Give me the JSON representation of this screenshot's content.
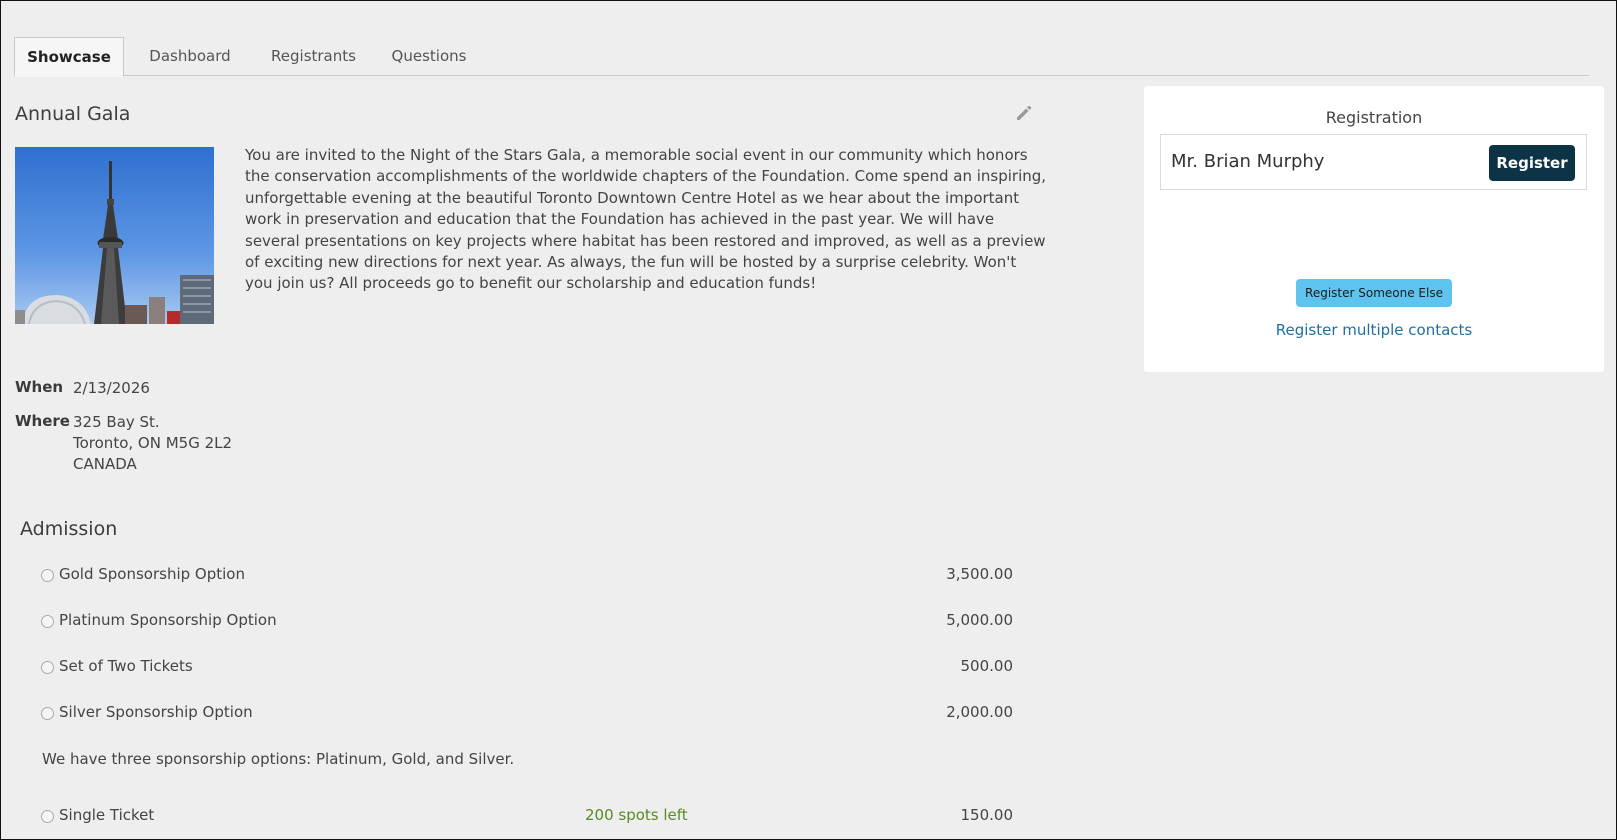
{
  "tabs": [
    {
      "label": "Showcase",
      "active": true
    },
    {
      "label": "Dashboard",
      "active": false
    },
    {
      "label": "Registrants",
      "active": false
    },
    {
      "label": "Questions",
      "active": false
    }
  ],
  "event": {
    "title": "Annual Gala",
    "description": "You are invited to the Night of the Stars Gala, a memorable social event in our community which honors the conservation accomplishments of the worldwide chapters of the Foundation. Come spend an inspiring, unforgettable evening at the beautiful Toronto Downtown Centre Hotel as we hear about the important work in preservation and education that the Foundation has achieved in the past year. We will have several presentations on key projects where habitat has been restored and improved, as well as a preview of exciting new directions for next year. As always, the fun will be hosted by a surprise celebrity. Won't you join us? All proceeds go to benefit our scholarship and education funds!",
    "when_label": "When",
    "when_value": "2/13/2026",
    "where_label": "Where",
    "where_line1": "325 Bay St.",
    "where_line2": "Toronto, ON M5G 2L2",
    "where_line3": "CANADA",
    "edit_icon": "pencil-icon"
  },
  "admission": {
    "title": "Admission",
    "options": [
      {
        "label": "Gold Sponsorship Option",
        "price": "3,500.00"
      },
      {
        "label": "Platinum Sponsorship Option",
        "price": "5,000.00"
      },
      {
        "label": "Set of Two Tickets",
        "price": "500.00"
      },
      {
        "label": "Silver Sponsorship Option",
        "price": "2,000.00"
      }
    ],
    "note": "We have three sponsorship options: Platinum, Gold, and Silver.",
    "single": {
      "label": "Single Ticket",
      "spots": "200 spots left",
      "price": "150.00"
    }
  },
  "registration": {
    "title": "Registration",
    "registrant_name": "Mr. Brian Murphy",
    "register_button": "Register",
    "register_else_button": "Register Someone Else",
    "register_multiple_link": "Register multiple contacts"
  },
  "colors": {
    "background": "#eeeeee",
    "register_button": "#0d3346",
    "register_else_button": "#5cc4ef",
    "link": "#1f6fa0",
    "spots_left": "#5a8a22"
  }
}
